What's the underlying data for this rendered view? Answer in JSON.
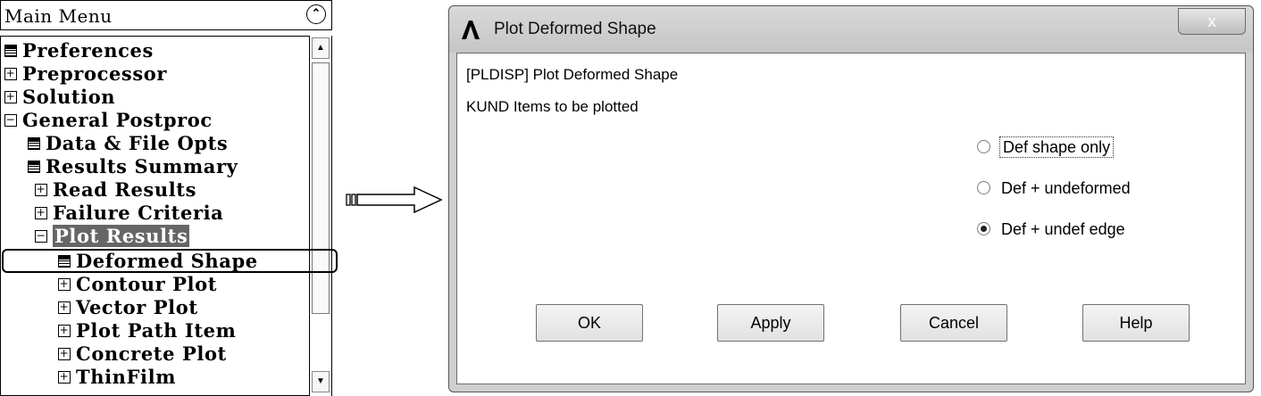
{
  "menu": {
    "title": "Main Menu",
    "collapse_icon": "double-chevron-up-icon",
    "items": [
      {
        "label": "Preferences",
        "icon": "page",
        "level": 0
      },
      {
        "label": "Preprocessor",
        "icon": "plus",
        "level": 0
      },
      {
        "label": "Solution",
        "icon": "plus",
        "level": 0
      },
      {
        "label": "General Postproc",
        "icon": "minus",
        "level": 0
      },
      {
        "label": "Data & File Opts",
        "icon": "page",
        "level": 1
      },
      {
        "label": "Results Summary",
        "icon": "page",
        "level": 1
      },
      {
        "label": "Read Results",
        "icon": "plus",
        "level": 1
      },
      {
        "label": "Failure Criteria",
        "icon": "plus",
        "level": 1
      },
      {
        "label": "Plot Results",
        "icon": "minus",
        "level": 1,
        "selected": true
      },
      {
        "label": "Deformed Shape",
        "icon": "page",
        "level": 2,
        "highlighted": true
      },
      {
        "label": "Contour Plot",
        "icon": "plus",
        "level": 2
      },
      {
        "label": "Vector Plot",
        "icon": "plus",
        "level": 2
      },
      {
        "label": "Plot Path Item",
        "icon": "plus",
        "level": 2
      },
      {
        "label": "Concrete Plot",
        "icon": "plus",
        "level": 2
      },
      {
        "label": "ThinFilm",
        "icon": "plus",
        "level": 2
      }
    ]
  },
  "dialog": {
    "title": "Plot Deformed Shape",
    "close_label": "x",
    "command_line": "[PLDISP]  Plot Deformed Shape",
    "kund_line": "KUND   Items to be plotted",
    "options": [
      {
        "label": "Def shape only",
        "checked": false,
        "focused": true
      },
      {
        "label": "Def + undeformed",
        "checked": false
      },
      {
        "label": "Def + undef edge",
        "checked": true
      }
    ],
    "buttons": {
      "ok": "OK",
      "apply": "Apply",
      "cancel": "Cancel",
      "help": "Help"
    }
  }
}
